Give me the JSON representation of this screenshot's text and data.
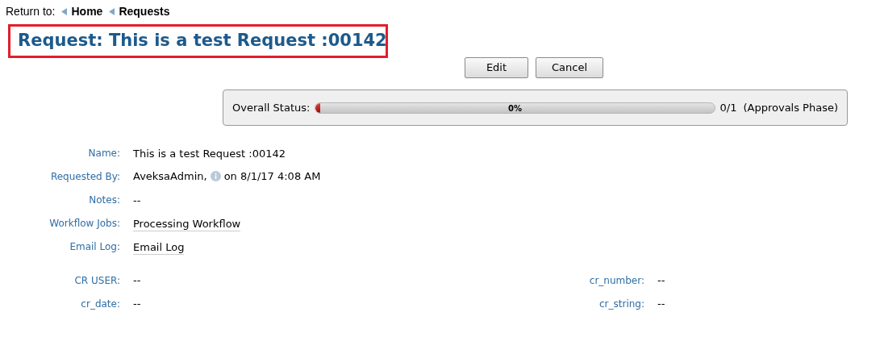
{
  "breadcrumb": {
    "label": "Return to:",
    "links": [
      "Home",
      "Requests"
    ]
  },
  "title": "Request: This is a test Request :00142",
  "buttons": [
    "Edit",
    "Cancel"
  ],
  "status": {
    "label": "Overall Status:",
    "level": 0,
    "percent": "0%",
    "count": "0/1",
    "phase": "(Approvals Phase)"
  },
  "fields": [
    {
      "label": "Name:",
      "kind": "text",
      "value": "This is a test Request :00142"
    },
    {
      "label": "Requested By:",
      "kind": "user",
      "value": "AveksaAdmin,",
      "suffix": "on 8/1/17 4:08 AM"
    },
    {
      "label": "Notes:",
      "kind": "text",
      "value": "--"
    },
    {
      "label": "Workflow Jobs:",
      "kind": "link",
      "value": "Processing Workflow"
    },
    {
      "label": "Email Log:",
      "kind": "link",
      "value": "Email Log"
    }
  ],
  "custom_fields": [
    [
      {
        "label": "CR USER:",
        "value": "--"
      },
      {
        "label": "cr_number:",
        "value": "--"
      }
    ],
    [
      {
        "label": "cr_date:",
        "value": "--"
      },
      {
        "label": "cr_string:",
        "value": "--"
      }
    ]
  ]
}
